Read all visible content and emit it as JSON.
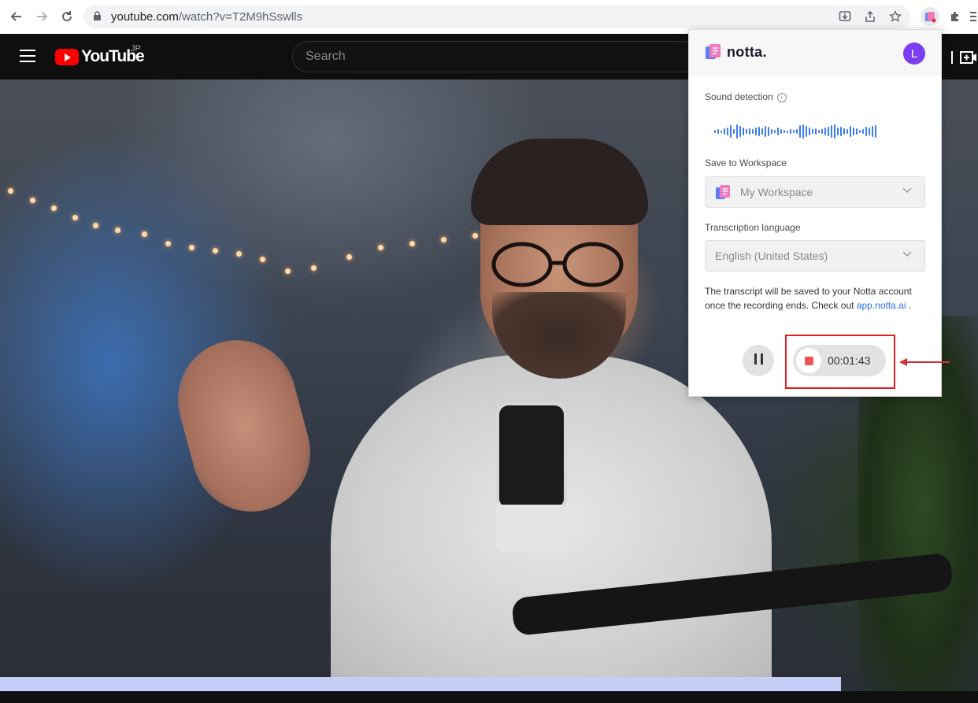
{
  "browser": {
    "url_host": "youtube.com",
    "url_path": "/watch?v=T2M9hSswlls"
  },
  "youtube": {
    "logo_text": "YouTube",
    "country_code": "JP",
    "search_placeholder": "Search"
  },
  "notta": {
    "brand": "notta.",
    "avatar_initial": "L",
    "sound_detection_label": "Sound detection",
    "info_glyph": "i",
    "save_to_workspace_label": "Save to Workspace",
    "workspace_value": "My Workspace",
    "transcription_language_label": "Transcription language",
    "language_value": "English (United States)",
    "note_text": "The transcript will be saved to your Notta account once the recording ends. Check out",
    "note_link": "app.notta.ai",
    "note_end": " .",
    "timer": "00:01:43"
  },
  "colors": {
    "notta_accent": "#7b3ff2",
    "waveform": "#3b7cf0",
    "record_stop": "#f05454",
    "annotation": "#e02020",
    "link": "#2f6de8"
  }
}
